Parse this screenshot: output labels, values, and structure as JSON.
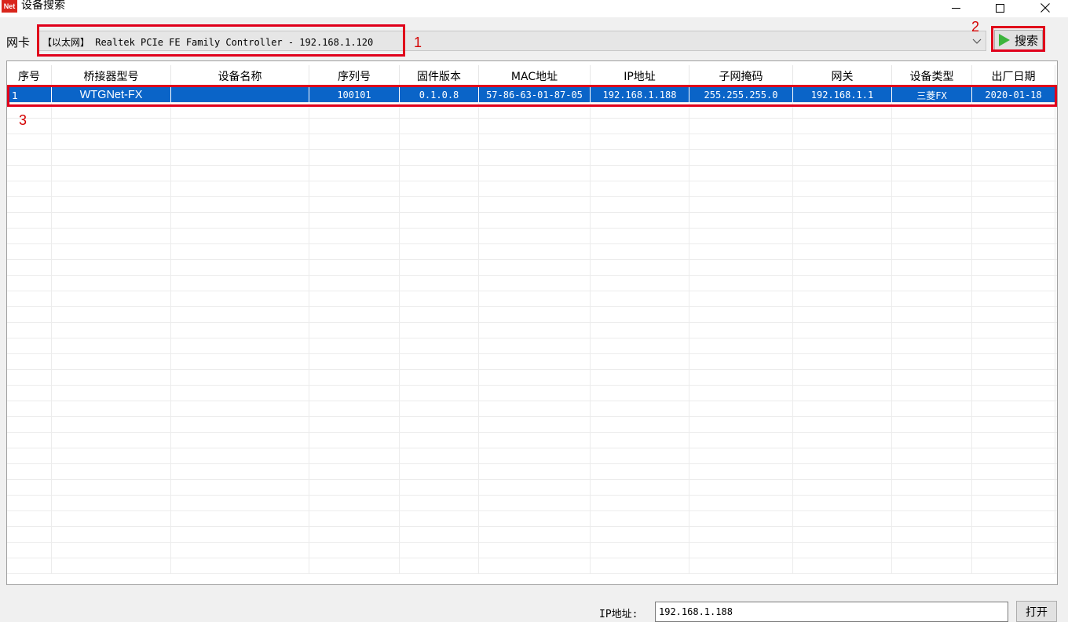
{
  "window": {
    "icon_text": "Net",
    "title": "设备搜索",
    "minimize_icon": "minimize-icon",
    "maximize_icon": "maximize-icon",
    "close_icon": "close-icon"
  },
  "nic": {
    "label": "网卡",
    "selected": "【以太网】 Realtek PCIe FE Family Controller - 192.168.1.120",
    "search_label": "搜索",
    "search_icon": "play-icon"
  },
  "annotations": {
    "n1": "1",
    "n2": "2",
    "n3": "3",
    "color": "#e0001b"
  },
  "table": {
    "columns": [
      "序号",
      "桥接器型号",
      "设备名称",
      "序列号",
      "固件版本",
      "MAC地址",
      "IP地址",
      "子网掩码",
      "网关",
      "设备类型",
      "出厂日期"
    ],
    "rows": [
      [
        "1",
        "WTGNet-FX",
        "",
        "100101",
        "0.1.0.8",
        "57-86-63-01-87-05",
        "192.168.1.188",
        "255.255.255.0",
        "192.168.1.1",
        "三菱FX",
        "2020-01-18"
      ]
    ],
    "selected_row": 0,
    "selection_color": "#0a64c8"
  },
  "footer": {
    "ip_label": "IP地址:",
    "ip_value": "192.168.1.188",
    "open_label": "打开"
  }
}
